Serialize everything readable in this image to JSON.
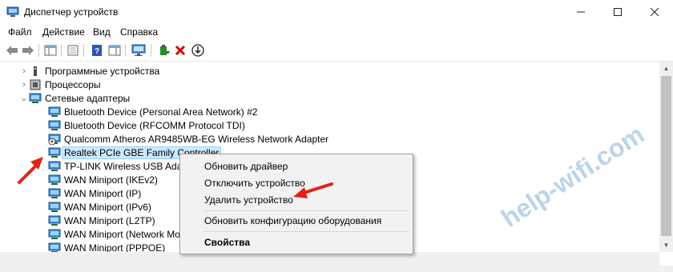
{
  "window": {
    "title": "Диспетчер устройств"
  },
  "menu": [
    "Файл",
    "Действие",
    "Вид",
    "Справка"
  ],
  "tree": [
    {
      "label": "Программные устройства",
      "icon": "software-device-icon",
      "expanded": false
    },
    {
      "label": "Процессоры",
      "icon": "processor-icon",
      "expanded": false
    },
    {
      "label": "Сетевые адаптеры",
      "icon": "network-adapter-icon",
      "expanded": true
    },
    {
      "label": "Bluetooth Device (Personal Area Network) #2",
      "icon": "network-adapter-icon"
    },
    {
      "label": "Bluetooth Device (RFCOMM Protocol TDI)",
      "icon": "network-adapter-icon"
    },
    {
      "label": "Qualcomm Atheros AR9485WB-EG Wireless Network Adapter",
      "icon": "network-adapter-disabled-icon"
    },
    {
      "label": "Realtek PCIe GBE Family Controller",
      "icon": "network-adapter-icon",
      "selected": true
    },
    {
      "label": "TP-LINK Wireless USB Adapt",
      "icon": "network-adapter-icon"
    },
    {
      "label": "WAN Miniport (IKEv2)",
      "icon": "network-adapter-icon"
    },
    {
      "label": "WAN Miniport (IP)",
      "icon": "network-adapter-icon"
    },
    {
      "label": "WAN Miniport (IPv6)",
      "icon": "network-adapter-icon"
    },
    {
      "label": "WAN Miniport (L2TP)",
      "icon": "network-adapter-icon"
    },
    {
      "label": "WAN Miniport (Network Mo",
      "icon": "network-adapter-icon"
    },
    {
      "label": "WAN Miniport (PPPOE)",
      "icon": "network-adapter-icon"
    }
  ],
  "context_menu": {
    "update_driver": "Обновить драйвер",
    "disable_device": "Отключить устройство",
    "uninstall_device": "Удалить устройство",
    "scan_hardware": "Обновить конфигурацию оборудования",
    "properties": "Свойства"
  },
  "watermark": "help-wifi.com",
  "colors": {
    "selection": "#cce8ff",
    "arrow": "#e32119",
    "watermark": "#bcd4ea"
  }
}
